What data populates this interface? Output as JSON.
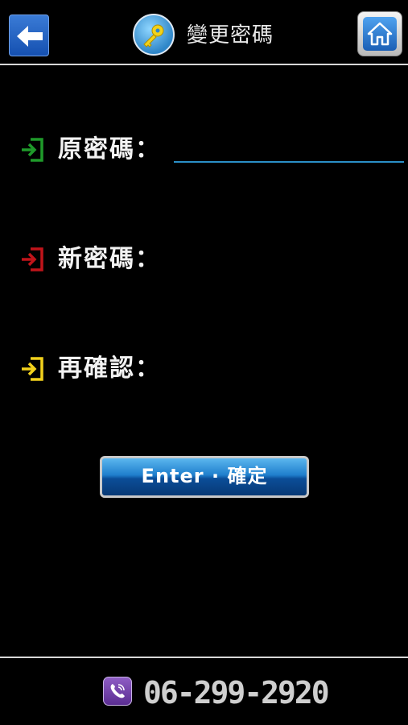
{
  "header": {
    "title": "變更密碼",
    "back_icon": "back-arrow-icon",
    "title_icon": "key-icon",
    "home_icon": "home-icon"
  },
  "form": {
    "fields": [
      {
        "label": "原密碼：",
        "value": "",
        "icon": "enter-arrow-icon",
        "icon_color": "#1f9a2a",
        "active": true
      },
      {
        "label": "新密碼：",
        "value": "",
        "icon": "enter-arrow-icon",
        "icon_color": "#c0141a",
        "active": false
      },
      {
        "label": "再確認：",
        "value": "",
        "icon": "enter-arrow-icon",
        "icon_color": "#f2d11c",
        "active": false
      }
    ],
    "submit_label": "Enter · 確定"
  },
  "footer": {
    "phone": "06-299-2920",
    "phone_icon": "viber-phone-icon"
  },
  "colors": {
    "background": "#000000",
    "accent_blue": "#2a8fc7",
    "divider": "#d8d8d8"
  }
}
